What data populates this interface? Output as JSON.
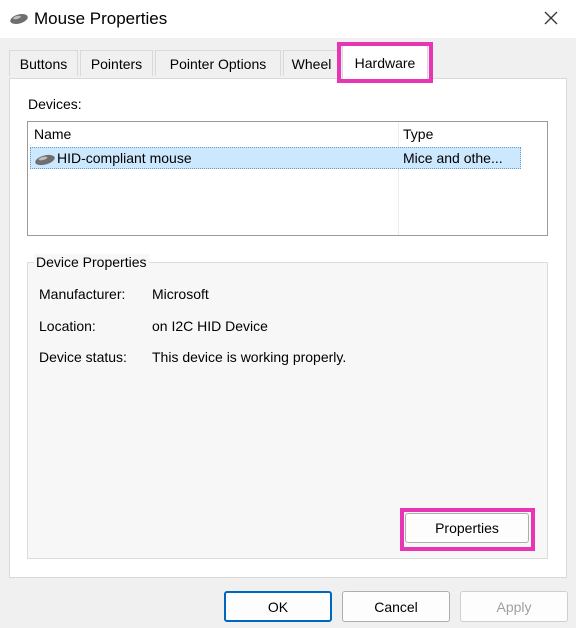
{
  "window": {
    "title": "Mouse Properties"
  },
  "tabs": [
    "Buttons",
    "Pointers",
    "Pointer Options",
    "Wheel",
    "Hardware"
  ],
  "devices": {
    "label": "Devices:",
    "columns": [
      "Name",
      "Type"
    ],
    "rows": [
      {
        "name": "HID-compliant mouse",
        "type": "Mice and othe..."
      }
    ]
  },
  "device_properties": {
    "title": "Device Properties",
    "fields": [
      {
        "label": "Manufacturer:",
        "value": "Microsoft"
      },
      {
        "label": "Location:",
        "value": "on I2C HID Device"
      },
      {
        "label": "Device status:",
        "value": "This device is working properly."
      }
    ],
    "properties_button": "Properties"
  },
  "footer": {
    "ok": "OK",
    "cancel": "Cancel",
    "apply": "Apply"
  },
  "colors": {
    "highlight": "#e636b4",
    "selection": "#cce8ff",
    "accent": "#0067c0"
  },
  "icons": {
    "window": "mouse-icon",
    "close": "close-icon",
    "device": "mouse-icon"
  }
}
